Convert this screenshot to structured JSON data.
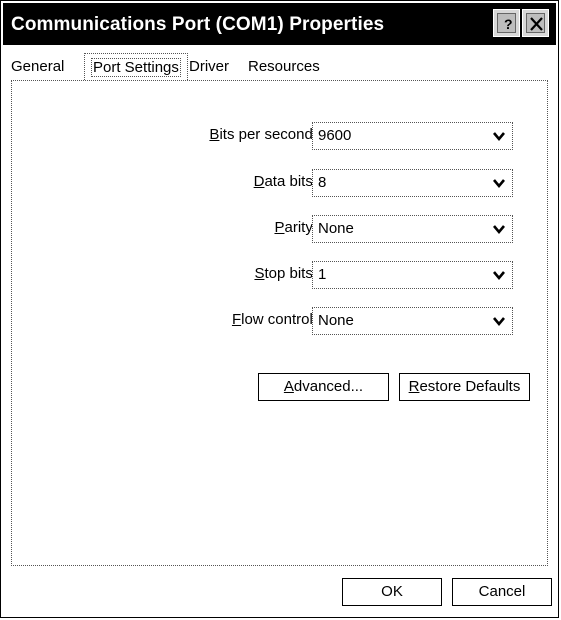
{
  "window": {
    "title": "Communications Port (COM1) Properties",
    "help_icon": "help-icon",
    "close_icon": "close-icon"
  },
  "tabs": [
    {
      "label": "General"
    },
    {
      "label": "Port Settings",
      "selected": true
    },
    {
      "label": "Driver"
    },
    {
      "label": "Resources"
    }
  ],
  "settings": [
    {
      "label_prefix": "",
      "label_accel": "B",
      "label_rest": "its per second:",
      "value": "9600"
    },
    {
      "label_prefix": "",
      "label_accel": "D",
      "label_rest": "ata bits:",
      "value": "8"
    },
    {
      "label_prefix": "",
      "label_accel": "P",
      "label_rest": "arity:",
      "value": "None"
    },
    {
      "label_prefix": "",
      "label_accel": "S",
      "label_rest": "top bits:",
      "value": "1"
    },
    {
      "label_prefix": "",
      "label_accel": "F",
      "label_rest": "low control:",
      "value": "None"
    }
  ],
  "buttons": {
    "advanced_accel": "A",
    "advanced_rest": "dvanced...",
    "restore_accel": "R",
    "restore_rest": "estore Defaults",
    "ok": "OK",
    "cancel": "Cancel"
  }
}
